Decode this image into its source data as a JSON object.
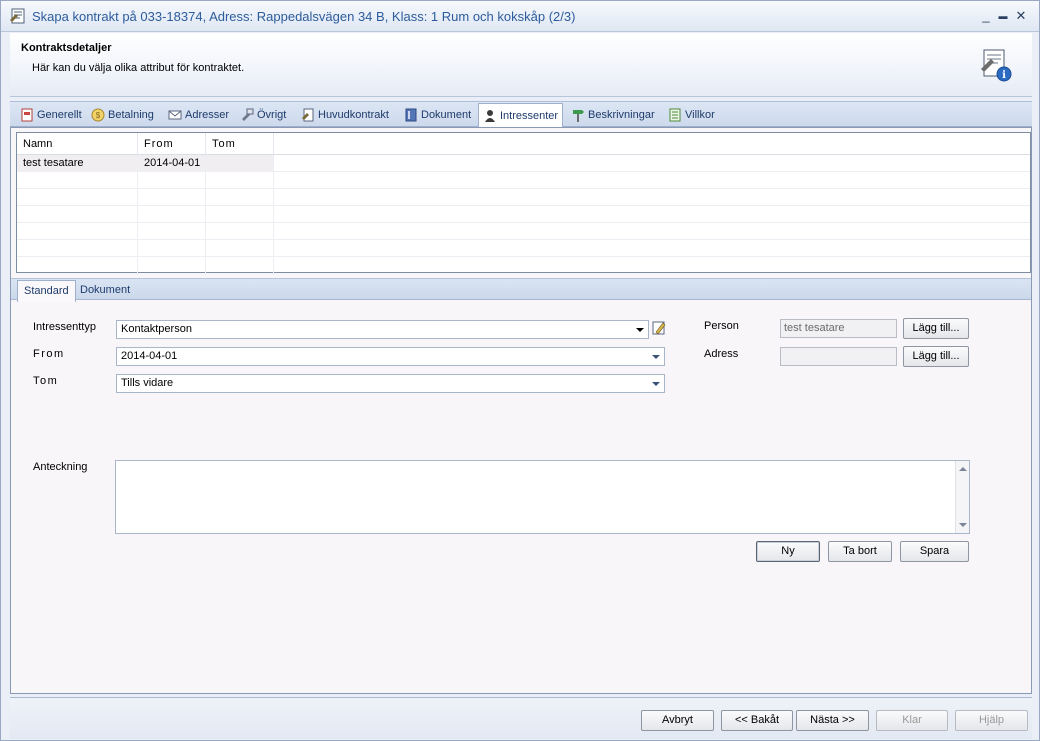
{
  "window": {
    "title": "Skapa kontrakt på 033-18374, Adress: Rappedalsvägen 34 B, Klass: 1 Rum och kokskåp (2/3)",
    "minimize": "_",
    "maximize": "▬",
    "close": "✕"
  },
  "header": {
    "title": "Kontraktsdetaljer",
    "subtitle": "Här kan du välja olika attribut för kontraktet."
  },
  "tabs": [
    {
      "label": "Generellt",
      "icon": "document-icon"
    },
    {
      "label": "Betalning",
      "icon": "coin-icon"
    },
    {
      "label": "Adresser",
      "icon": "envelope-icon"
    },
    {
      "label": "Övrigt",
      "icon": "tools-icon"
    },
    {
      "label": "Huvudkontrakt",
      "icon": "contract-icon"
    },
    {
      "label": "Dokument",
      "icon": "binder-icon"
    },
    {
      "label": "Intressenter",
      "icon": "person-icon"
    },
    {
      "label": "Beskrivningar",
      "icon": "signpost-icon"
    },
    {
      "label": "Villkor",
      "icon": "list-icon"
    }
  ],
  "active_tab": "Intressenter",
  "grid": {
    "columns": [
      "Namn",
      "From",
      "Tom"
    ],
    "rows": [
      [
        "test tesatare",
        "2014-04-01",
        ""
      ]
    ]
  },
  "subtabs": [
    "Standard",
    "Dokument"
  ],
  "form": {
    "intressenttyp_label": "Intressenttyp",
    "intressenttyp_value": "Kontaktperson",
    "from_label": "From",
    "from_value": "2014-04-01",
    "tom_label": "Tom",
    "tom_value": "Tills vidare",
    "person_label": "Person",
    "person_value": "test tesatare",
    "adress_label": "Adress",
    "adress_value": "",
    "lagg_till_label": "Lägg till...",
    "anteckning_label": "Anteckning",
    "anteckning_value": "",
    "ny_label": "Ny",
    "ta_bort_label": "Ta bort",
    "spara_label": "Spara"
  },
  "footer": {
    "avbryt": "Avbryt",
    "bakat": "<< Bakåt",
    "nasta": "Nästa >>",
    "klar": "Klar",
    "hjalp": "Hjälp"
  }
}
